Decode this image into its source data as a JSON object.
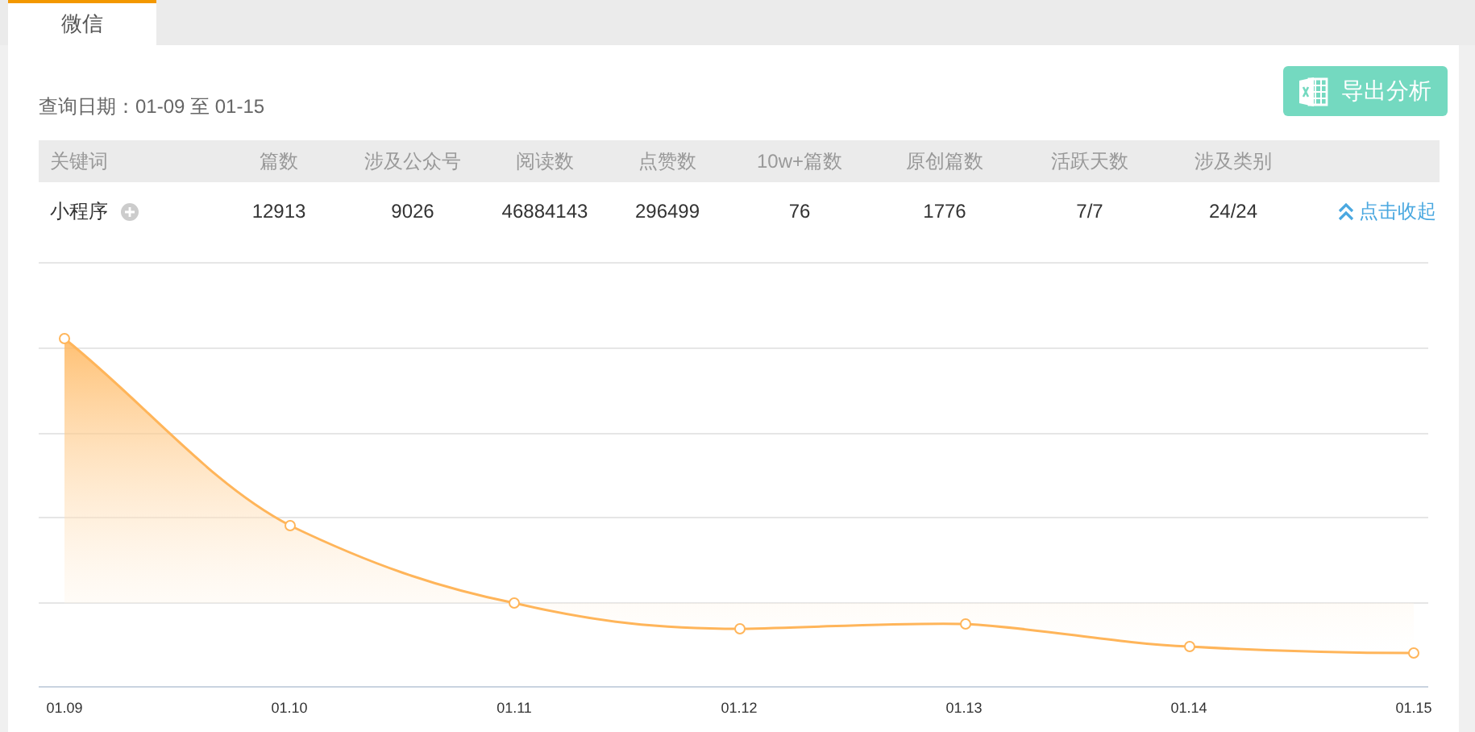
{
  "tabs": [
    {
      "label": "微信",
      "selected": true
    }
  ],
  "query_date": "查询日期：01-09 至 01-15",
  "export_button": "导出分析",
  "table": {
    "columns": [
      "关键词",
      "篇数",
      "涉及公众号",
      "阅读数",
      "点赞数",
      "10w+篇数",
      "原创篇数",
      "活跃天数",
      "涉及类别"
    ],
    "rows": [
      {
        "cells": [
          "小程序",
          "12913",
          "9026",
          "46884143",
          "296499",
          "76",
          "1776",
          "7/7",
          "24/24"
        ],
        "expanded": true,
        "toggle_label": "点击收起"
      }
    ]
  },
  "chart": {
    "x_labels": [
      "01.09",
      "01.10",
      "01.11",
      "01.12",
      "01.13",
      "01.14",
      "01.15"
    ]
  }
}
